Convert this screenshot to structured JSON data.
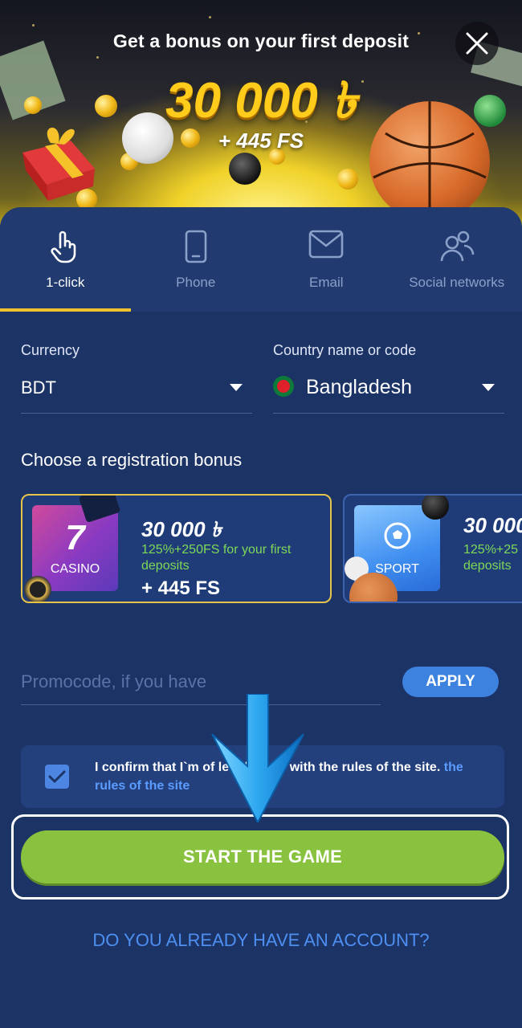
{
  "banner": {
    "title": "Get a bonus on your first deposit",
    "amount": "30 000 ৳",
    "free_spins": "+ 445 FS"
  },
  "tabs": [
    {
      "label": "1-click",
      "icon": "hand-pointer-icon",
      "active": true
    },
    {
      "label": "Phone",
      "icon": "smartphone-icon",
      "active": false
    },
    {
      "label": "Email",
      "icon": "envelope-icon",
      "active": false
    },
    {
      "label": "Social networks",
      "icon": "users-icon",
      "active": false
    }
  ],
  "form": {
    "currency_label": "Currency",
    "currency_value": "BDT",
    "country_label": "Country name or code",
    "country_value": "Bangladesh"
  },
  "bonus": {
    "section_title": "Choose a registration bonus",
    "cards": [
      {
        "thumb_label": "CASINO",
        "thumb_glyph": "7",
        "amount": "30 000 ৳",
        "description": "125%+250FS for your first deposits",
        "free_spins": "+ 445 FS",
        "selected": true
      },
      {
        "thumb_label": "SPORT",
        "amount": "30 000",
        "description": "125%+25 deposits",
        "selected": false
      }
    ]
  },
  "promo": {
    "placeholder": "Promocode, if you have",
    "apply_label": "APPLY"
  },
  "confirm": {
    "text": "I confirm that I`m of le     nd agree with the rules of the site.",
    "link_text": "the rules of the site",
    "checked": true
  },
  "start_button": "START THE GAME",
  "login_link": "DO YOU ALREADY HAVE AN ACCOUNT?",
  "colors": {
    "panel_bg": "#1c3366",
    "tab_bar_bg": "#213a70",
    "accent_yellow": "#f2c12e",
    "start_green": "#89c23e",
    "link_blue": "#4e8ff2",
    "bonus_green_text": "#7ed957"
  }
}
